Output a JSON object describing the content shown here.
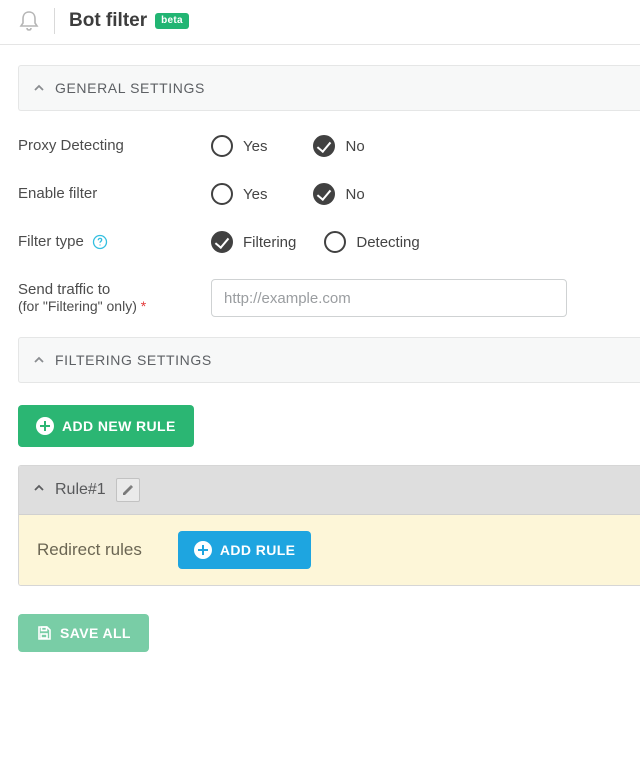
{
  "header": {
    "title": "Bot filter",
    "badge": "beta"
  },
  "sections": {
    "general": {
      "label": "GENERAL SETTINGS"
    },
    "filtering": {
      "label": "FILTERING SETTINGS"
    }
  },
  "settings": {
    "proxy_detecting": {
      "label": "Proxy Detecting",
      "options": {
        "yes": "Yes",
        "no": "No"
      },
      "value": "no"
    },
    "enable_filter": {
      "label": "Enable filter",
      "options": {
        "yes": "Yes",
        "no": "No"
      },
      "value": "no"
    },
    "filter_type": {
      "label": "Filter type",
      "options": {
        "filtering": "Filtering",
        "detecting": "Detecting"
      },
      "value": "filtering"
    },
    "send_traffic": {
      "label": "Send traffic to",
      "sublabel": "(for \"Filtering\" only)",
      "required_mark": "*",
      "placeholder": "http://example.com",
      "value": ""
    }
  },
  "buttons": {
    "add_new_rule": "ADD NEW RULE",
    "add_rule": "ADD RULE",
    "save_all": "SAVE ALL"
  },
  "rule": {
    "name": "Rule#1",
    "redirect_label": "Redirect rules"
  },
  "icons": {
    "bell": "bell-icon",
    "chevron_up": "chevron-up-icon",
    "help": "help-icon",
    "plus": "plus-icon",
    "pencil": "pencil-icon",
    "disk": "save-disk-icon"
  }
}
